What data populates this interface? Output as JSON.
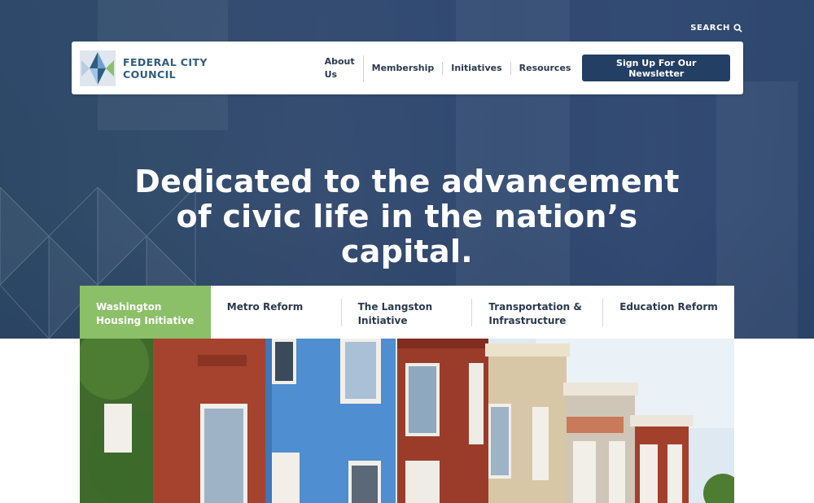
{
  "header": {
    "logo_line1": "FEDERAL CITY",
    "logo_line2": "COUNCIL",
    "search_label": "SEARCH",
    "nav": [
      "About Us",
      "Membership",
      "Initiatives",
      "Resources"
    ],
    "newsletter_label": "Sign Up For Our Newsletter"
  },
  "hero": {
    "headline_line1": "Dedicated to the advancement",
    "headline_line2": "of civic life in the nation’s",
    "headline_line3": "capital."
  },
  "tabs": [
    {
      "line1": "Washington",
      "line2": "Housing Initiative",
      "active": true
    },
    {
      "line1": "Metro Reform",
      "line2": "",
      "active": false
    },
    {
      "line1": "The Langston",
      "line2": "Initiative",
      "active": false
    },
    {
      "line1": "Transportation &",
      "line2": "Infrastructure",
      "active": false
    },
    {
      "line1": "Education Reform",
      "line2": "",
      "active": false
    }
  ],
  "colors": {
    "brand_navy": "#233f64",
    "accent_green": "#8cc068",
    "logo_blue": "#2f5d80"
  },
  "icons": {
    "search": "search-icon",
    "logo": "fcc-logo-mark"
  }
}
